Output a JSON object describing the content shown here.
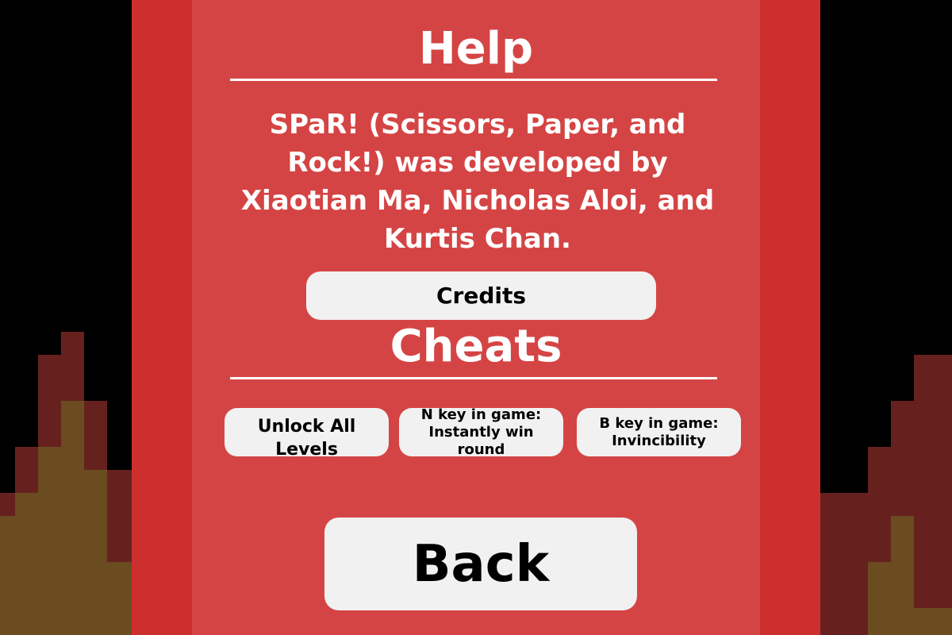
{
  "help_screen": {
    "help_heading": "Help",
    "about_text": "SPaR! (Scissors, Paper, and Rock!) was developed by Xiaotian Ma, Nicholas Aloi, and Kurtis Chan.",
    "credits_button": "Credits",
    "cheats_heading": "Cheats",
    "cheats": [
      "Unlock All Levels",
      "N key in game: Instantly win round",
      "B key in game: Invincibility"
    ],
    "back_button": "Back"
  },
  "colors": {
    "background": "#000000",
    "panel_outer": "#cd2f2f",
    "panel_inner": "#d54444",
    "button": "#f1f1f1",
    "flame_dark": "#66211f",
    "flame_light": "#6b4b20"
  }
}
